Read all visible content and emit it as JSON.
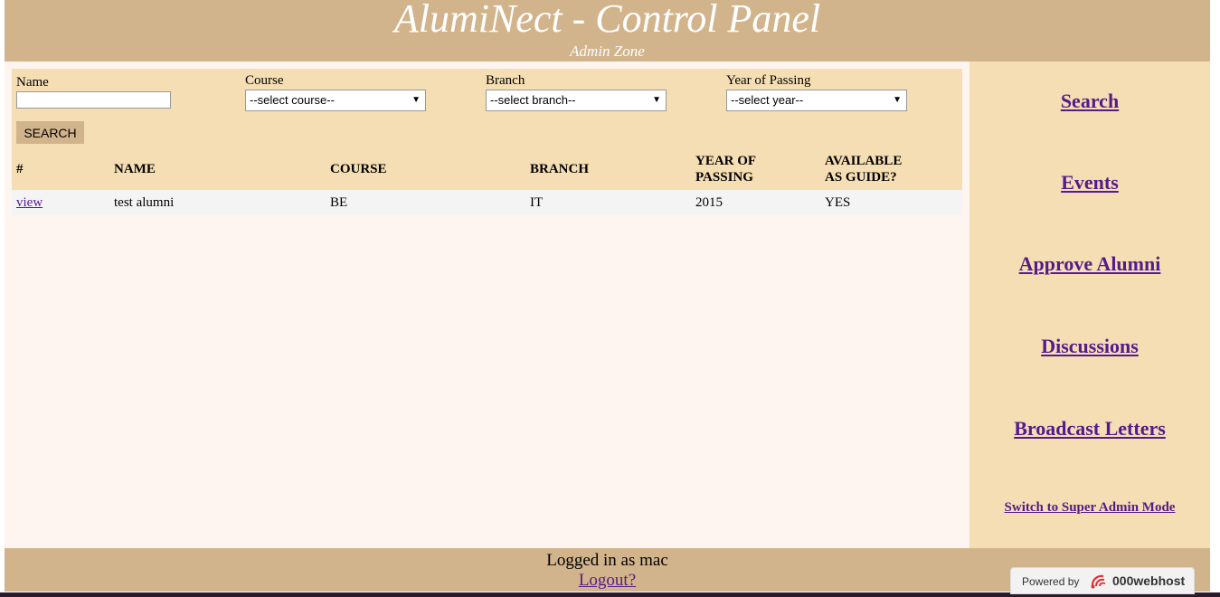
{
  "header": {
    "title": "AlumiNect - Control Panel",
    "subtitle": "Admin Zone"
  },
  "search": {
    "name_label": "Name",
    "name_value": "",
    "course_label": "Course",
    "course_selected": "--select course--",
    "branch_label": "Branch",
    "branch_selected": "--select branch--",
    "year_label": "Year of Passing",
    "year_selected": "--select year--",
    "button_label": "SEARCH"
  },
  "table": {
    "headers": {
      "index": "#",
      "name": "NAME",
      "course": "COURSE",
      "branch": "BRANCH",
      "year_line1": "YEAR OF",
      "year_line2": "PASSING",
      "guide_line1": "AVAILABLE",
      "guide_line2": "AS GUIDE?"
    },
    "rows": [
      {
        "link": "view",
        "name": "test alumni",
        "course": "BE",
        "branch": "IT",
        "year": "2015",
        "guide": "YES"
      }
    ]
  },
  "sidebar": {
    "items": [
      {
        "label": "Search"
      },
      {
        "label": "Events"
      },
      {
        "label": "Approve Alumni"
      },
      {
        "label": "Discussions"
      },
      {
        "label": "Broadcast Letters"
      },
      {
        "label": "Switch to Super Admin Mode"
      }
    ]
  },
  "footer": {
    "logged_in_text": "Logged in as mac",
    "logout_label": "Logout?"
  },
  "badge": {
    "powered_by": "Powered by",
    "brand": "000webhost",
    "logo_icon": "000webhost-logo-icon"
  },
  "colors": {
    "header_bg": "#d2b48c",
    "panel_bg": "#f5deb3",
    "main_bg": "#fff5f0",
    "link": "#551a8b"
  }
}
